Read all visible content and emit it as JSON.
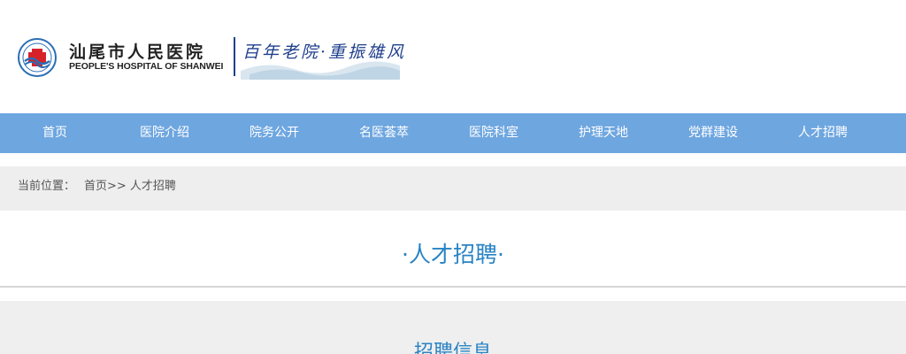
{
  "header": {
    "hospital_name_cn": "汕尾市人民医院",
    "hospital_name_en": "PEOPLE'S HOSPITAL OF SHANWEI",
    "slogan": "百年老院·重振雄风",
    "logo_icon": "hospital-emblem-icon",
    "brand_color": "#1f3f8c"
  },
  "nav": {
    "color": "#6ea6e0",
    "items": [
      {
        "label": "首页"
      },
      {
        "label": "医院介绍"
      },
      {
        "label": "院务公开"
      },
      {
        "label": "名医荟萃"
      },
      {
        "label": "医院科室"
      },
      {
        "label": "护理天地"
      },
      {
        "label": "党群建设"
      },
      {
        "label": "人才招聘"
      }
    ]
  },
  "breadcrumb": {
    "label": "当前位置：",
    "home": "首页",
    "separator": ">>",
    "current": "人才招聘"
  },
  "page": {
    "title": "·人才招聘·",
    "title_color": "#2a84c4"
  },
  "content": {
    "section_title": "招聘信息"
  }
}
